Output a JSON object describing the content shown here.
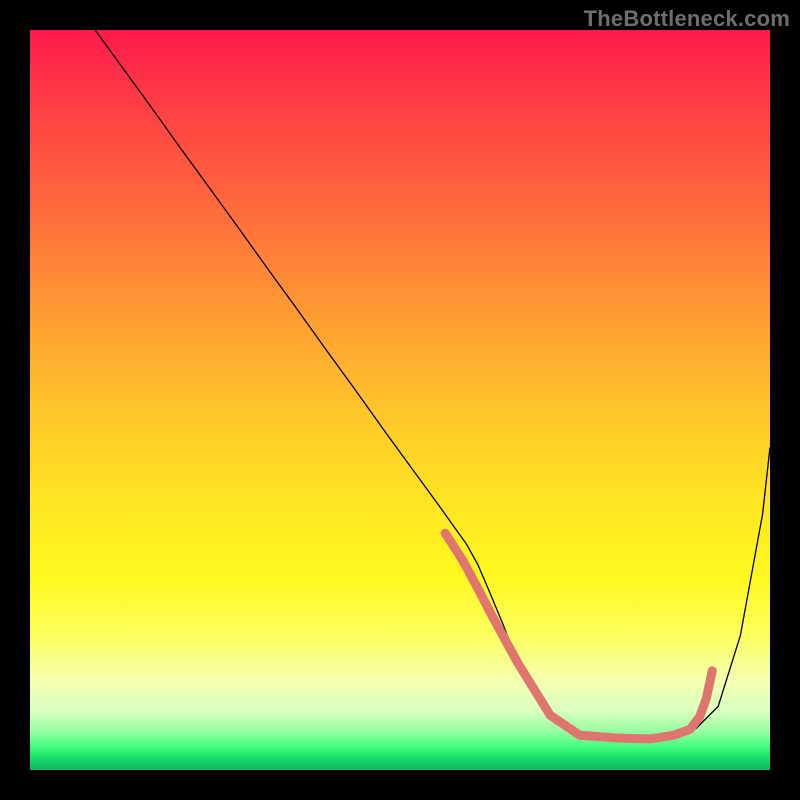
{
  "attribution": "TheBottleneck.com",
  "chart_data": {
    "type": "line",
    "title": "",
    "xlabel": "",
    "ylabel": "",
    "xlim": [
      0,
      100
    ],
    "ylim": [
      0,
      100
    ],
    "grid": false,
    "series": [
      {
        "name": "curve",
        "stroke": "#000000",
        "stroke_width": 1.3,
        "x": [
          8.8,
          12,
          16,
          20,
          24,
          28,
          32,
          36,
          40,
          44,
          48,
          52,
          55,
          57,
          59,
          60.5,
          62,
          64,
          66,
          68,
          70,
          72,
          73.5,
          75,
          78,
          81,
          84,
          87,
          90,
          93,
          96,
          99,
          100
        ],
        "y": [
          100,
          95.6,
          90.1,
          84.5,
          79.0,
          73.5,
          67.9,
          62.4,
          56.8,
          51.3,
          45.7,
          40.2,
          36.1,
          33.3,
          30.5,
          27.8,
          24.3,
          19.5,
          14.0,
          10.2,
          7.6,
          5.7,
          4.8,
          4.4,
          4.2,
          4.2,
          4.4,
          4.8,
          5.6,
          8.6,
          18.2,
          34.6,
          43.6
        ]
      },
      {
        "name": "optimal-band-marker",
        "stroke": "#e0756f",
        "stroke_width": 9,
        "linecap": "round",
        "x": [
          56.1,
          57.6,
          58.6,
          60.8,
          62.4,
          65.9,
          70.3,
          74.3,
          79.7,
          83.8,
          87.0,
          88.1,
          89.2,
          90.5,
          91.4,
          92.2
        ],
        "y": [
          32.0,
          29.7,
          28.1,
          24.0,
          20.9,
          14.5,
          7.4,
          4.7,
          4.3,
          4.2,
          4.7,
          5.1,
          5.5,
          7.2,
          9.7,
          13.4
        ]
      }
    ]
  }
}
